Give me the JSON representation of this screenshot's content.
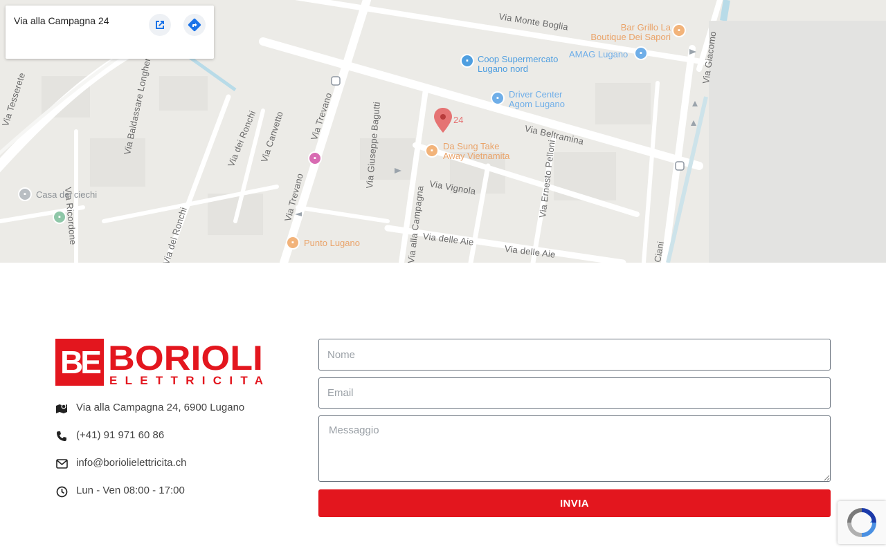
{
  "map": {
    "card": {
      "address": "Via alla Campagna 24",
      "open_icon": "open-in-new-icon",
      "directions_icon": "directions-icon"
    },
    "pin_label": "24",
    "streets": [
      "Via Monte Boglia",
      "Via Trevano",
      "Via Trevano",
      "Via dei Ronchi",
      "Via Canvetto",
      "Via Giuseppe Bagutti",
      "Via alla Campagna",
      "Via Vignola",
      "Via Beltramina",
      "Via Ernesto Pelloni",
      "Via delle Aie",
      "Via delle Aie",
      "Via Ricordone",
      "Via Baldassare Longhena",
      "Via dei Ronchi",
      "Via Tesserete",
      "Ciani",
      "Via Giacomo"
    ],
    "pois": {
      "coop": "Coop Supermercato Lugano nord",
      "amag": "AMAG Lugano",
      "bar_grillo": "Bar Grillo La Boutique Dei Sapori",
      "driver_center": "Driver Center Agom Lugano",
      "da_sung": "Da Sung Take Away Vietnamita",
      "casa_ciechi": "Casa dei ciechi",
      "punto_lugano": "Punto Lugano"
    },
    "colors": {
      "pin": "#ea4335",
      "food_poi": "#f29e56",
      "service_poi": "#4e9ee0",
      "hotel_poi": "#d86bb2"
    }
  },
  "logo": {
    "monogram": "BE",
    "name": "BORIOLI",
    "subtitle": "ELETTRICITA",
    "color": "#e3161e"
  },
  "contact": {
    "address": "Via alla Campagna 24, 6900 Lugano",
    "phone": "(+41) 91 971 60 86",
    "email": "info@boriolielettricita.ch",
    "hours": "Lun - Ven 08:00 - 17:00",
    "icons": [
      "map-icon",
      "phone-icon",
      "mail-icon",
      "clock-icon"
    ]
  },
  "form": {
    "name_placeholder": "Nome",
    "email_placeholder": "Email",
    "message_placeholder": "Messaggio",
    "submit_label": "INVIA",
    "accent": "#e3161e"
  }
}
